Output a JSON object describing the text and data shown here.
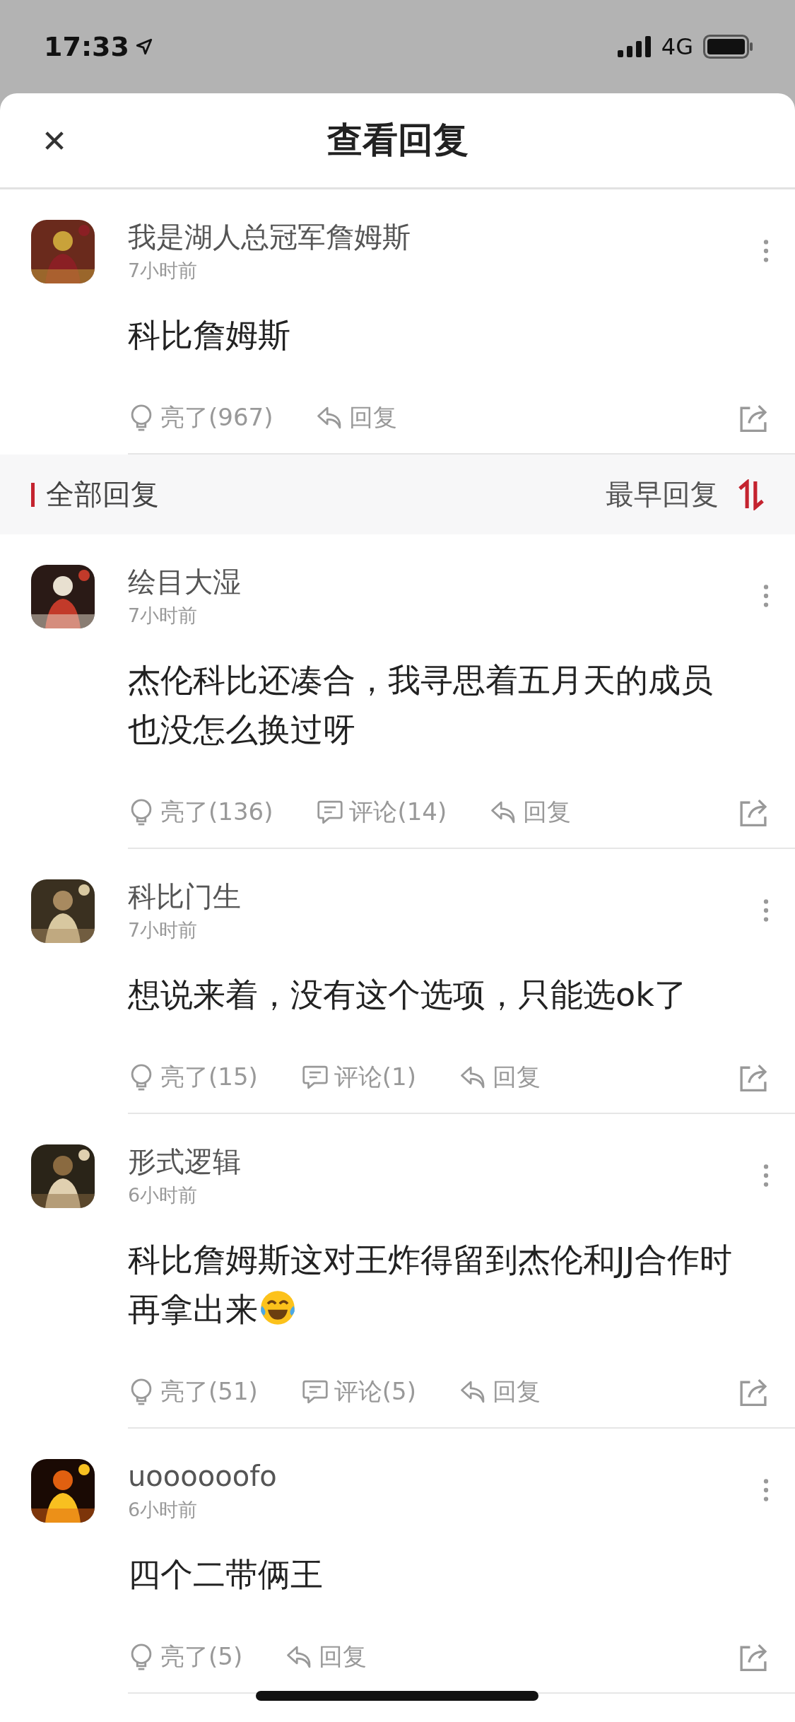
{
  "status_bar": {
    "time": "17:33",
    "network": "4G"
  },
  "header": {
    "title": "查看回复"
  },
  "main_comment": {
    "author": "我是湖人总冠军詹姆斯",
    "time": "7小时前",
    "content": "科比詹姆斯",
    "actions": [
      {
        "kind": "like",
        "label": "亮了(967)"
      },
      {
        "kind": "reply",
        "label": "回复"
      }
    ]
  },
  "section": {
    "title": "全部回复",
    "sort": "最早回复"
  },
  "replies": [
    {
      "author": "绘目大湿",
      "time": "7小时前",
      "content": "杰伦科比还凑合，我寻思着五月天的成员也没怎么换过呀",
      "actions": [
        {
          "kind": "like",
          "label": "亮了(136)"
        },
        {
          "kind": "comment",
          "label": "评论(14)"
        },
        {
          "kind": "reply",
          "label": "回复"
        }
      ]
    },
    {
      "author": "科比门生",
      "time": "7小时前",
      "content": "想说来着，没有这个选项，只能选ok了",
      "actions": [
        {
          "kind": "like",
          "label": "亮了(15)"
        },
        {
          "kind": "comment",
          "label": "评论(1)"
        },
        {
          "kind": "reply",
          "label": "回复"
        }
      ]
    },
    {
      "author": "形式逻辑",
      "time": "6小时前",
      "content": "科比詹姆斯这对王炸得留到杰伦和JJ合作时再拿出来",
      "laughing_emoji": true,
      "actions": [
        {
          "kind": "like",
          "label": "亮了(51)"
        },
        {
          "kind": "comment",
          "label": "评论(5)"
        },
        {
          "kind": "reply",
          "label": "回复"
        }
      ]
    },
    {
      "author": "uoooooofo",
      "time": "6小时前",
      "content": "四个二带俩王",
      "actions": [
        {
          "kind": "like",
          "label": "亮了(5)"
        },
        {
          "kind": "reply",
          "label": "回复"
        }
      ]
    }
  ]
}
